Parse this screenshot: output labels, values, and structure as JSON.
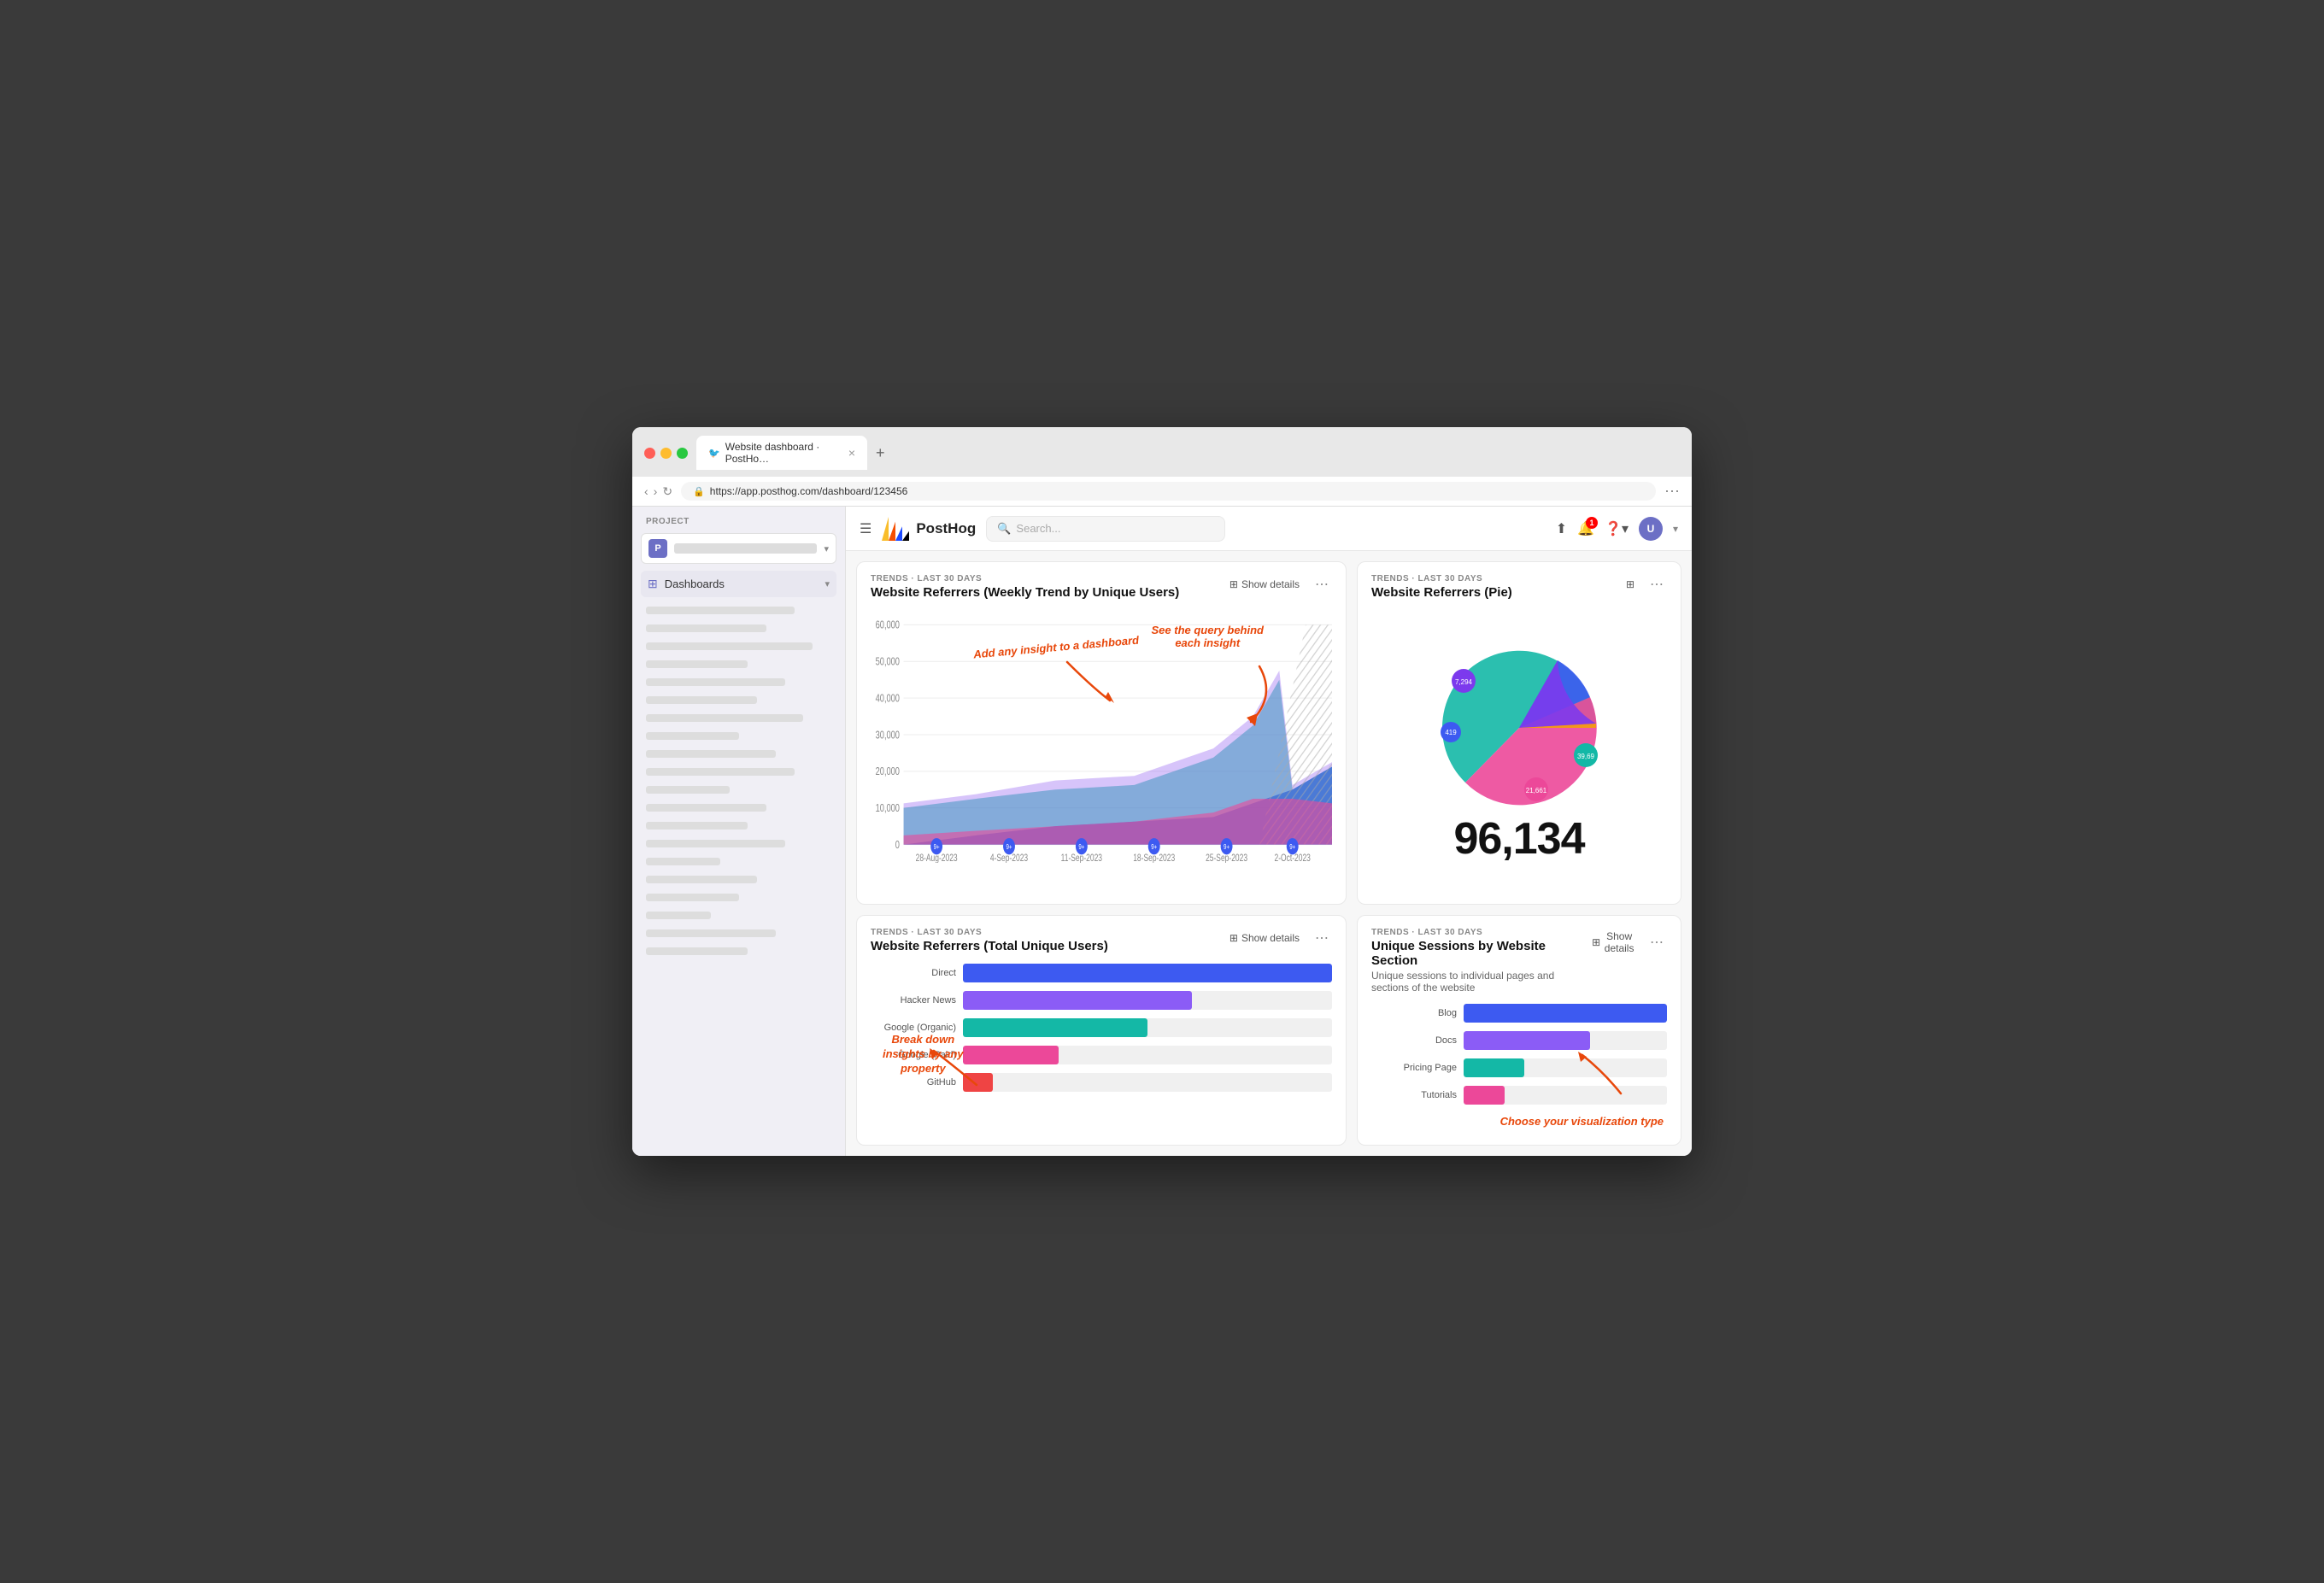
{
  "browser": {
    "url": "https://app.posthog.com/dashboard/123456",
    "tab_title": "Website dashboard · PostHo…",
    "new_tab_label": "+"
  },
  "app": {
    "logo_text": "PostHog",
    "search_placeholder": "Search...",
    "notification_count": "1"
  },
  "sidebar": {
    "project_label": "PROJECT",
    "project_badge": "P",
    "nav_items": [
      {
        "label": "Dashboards",
        "icon": "⊞",
        "active": true
      }
    ]
  },
  "cards": {
    "top_left": {
      "meta": "TRENDS · LAST 30 DAYS",
      "title": "Website Referrers (Weekly Trend by Unique Users)",
      "show_details": "Show details",
      "y_labels": [
        "60,000",
        "50,000",
        "40,000",
        "30,000",
        "20,000",
        "10,000",
        "0"
      ],
      "x_labels": [
        "28-Aug-2023",
        "4-Sep-2023",
        "11-Sep-2023",
        "18-Sep-2023",
        "25-Sep-2023",
        "2-Oct-2023"
      ],
      "dot_label": "9+",
      "annotation_add": "Add any insight to a dashboard",
      "annotation_query": "See the query behind\neach insight"
    },
    "top_right": {
      "meta": "TRENDS · LAST 30 DAYS",
      "title": "Website Referrers (Pie)",
      "total": "96,134",
      "labels": [
        "7,294",
        "419",
        "21,661",
        "39,69…"
      ]
    },
    "bottom_left": {
      "meta": "TRENDS · LAST 30 DAYS",
      "title": "Website Referrers (Total Unique Users)",
      "show_details": "Show details",
      "bars": [
        {
          "label": "Direct",
          "pct": 100,
          "color": "#3d5af1"
        },
        {
          "label": "Hacker News",
          "pct": 62,
          "color": "#8b5cf6"
        },
        {
          "label": "Google (Organic)",
          "pct": 50,
          "color": "#14b8a6"
        },
        {
          "label": "Google (Paid)",
          "pct": 26,
          "color": "#ec4899"
        },
        {
          "label": "GitHub",
          "pct": 8,
          "color": "#ef4444"
        }
      ],
      "annotation_breakdown": "Break down\ninsights by any\nproperty"
    },
    "bottom_right": {
      "meta": "TRENDS · LAST 30 DAYS",
      "title": "Unique Sessions by Website Section",
      "subtitle": "Unique sessions to individual pages and sections of the website",
      "show_details": "Show details",
      "bars": [
        {
          "label": "Blog",
          "pct": 100,
          "color": "#3d5af1"
        },
        {
          "label": "Docs",
          "pct": 62,
          "color": "#8b5cf6"
        },
        {
          "label": "Pricing Page",
          "pct": 30,
          "color": "#14b8a6"
        },
        {
          "label": "Tutorials",
          "pct": 20,
          "color": "#ec4899"
        }
      ],
      "annotation_viz": "Choose your visualization type"
    }
  }
}
